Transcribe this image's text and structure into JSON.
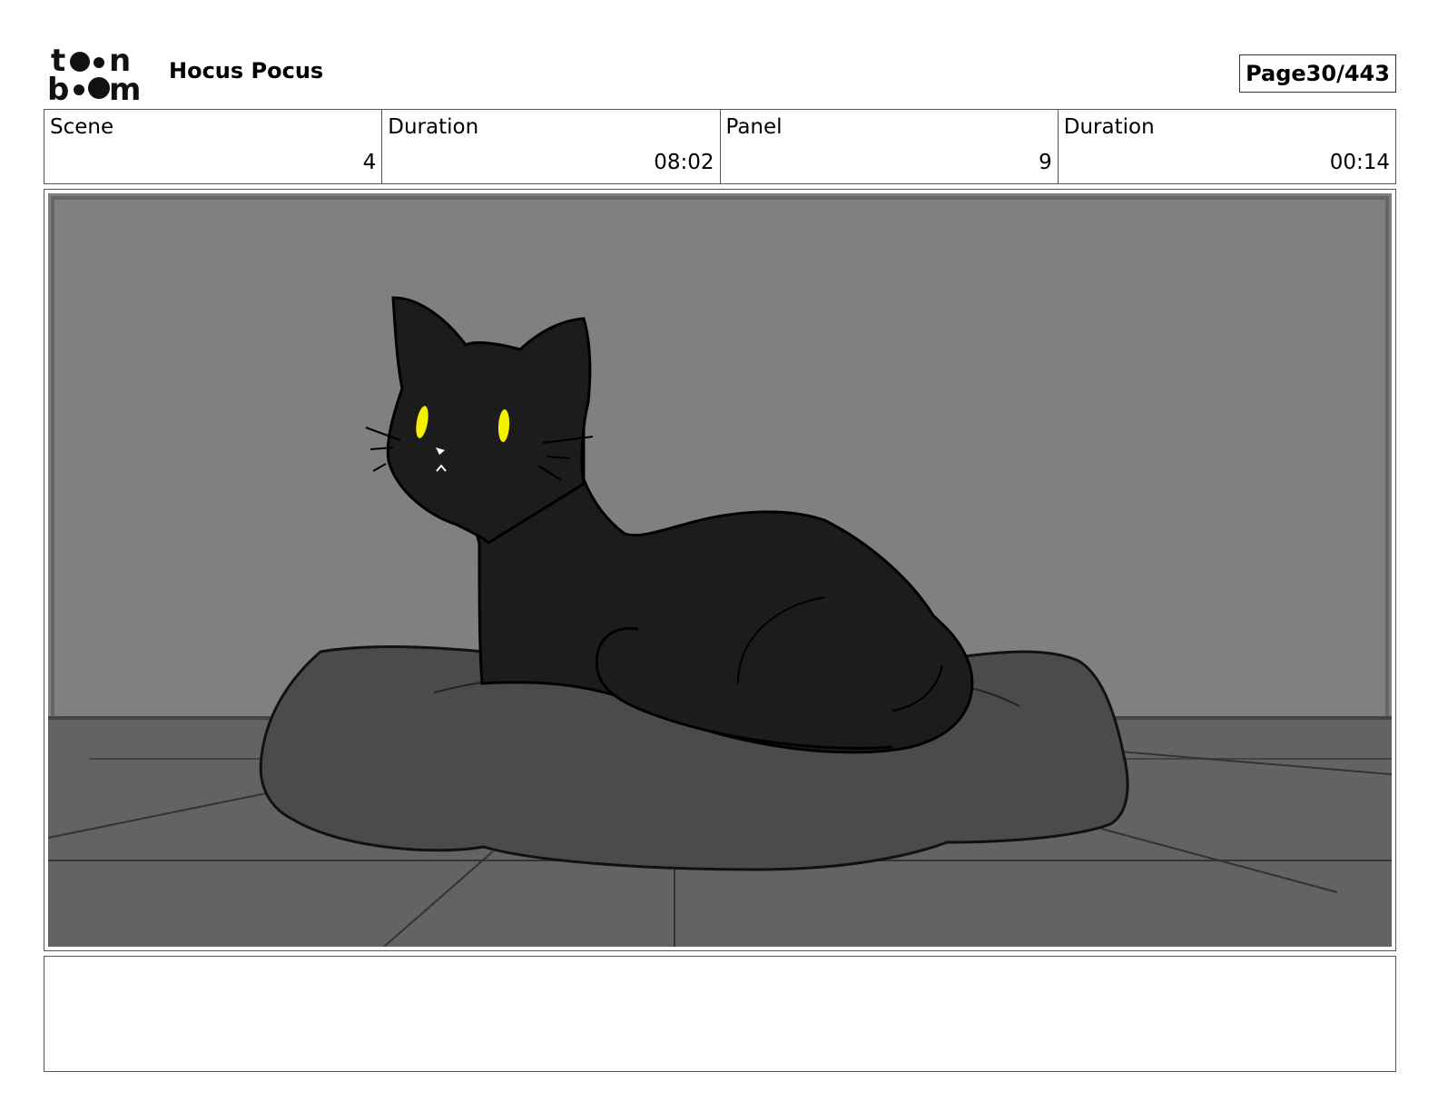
{
  "header": {
    "logo_text": "toon boom",
    "project_title": "Hocus Pocus",
    "page_label": "Page",
    "page_number": "30/443"
  },
  "info": {
    "scene_label": "Scene",
    "scene_value": "4",
    "scene_duration_label": "Duration",
    "scene_duration_value": "08:02",
    "panel_label": "Panel",
    "panel_value": "9",
    "panel_duration_label": "Duration",
    "panel_duration_value": "00:14"
  },
  "panel_image": {
    "icon": "black-cat-on-cushion-illustration",
    "colors": {
      "wall": "#808080",
      "floor": "#636363",
      "cushion": "#4b4b4b",
      "cat": "#1c1c1c",
      "eyes": "#f5f000"
    }
  },
  "notes": {
    "text": ""
  }
}
